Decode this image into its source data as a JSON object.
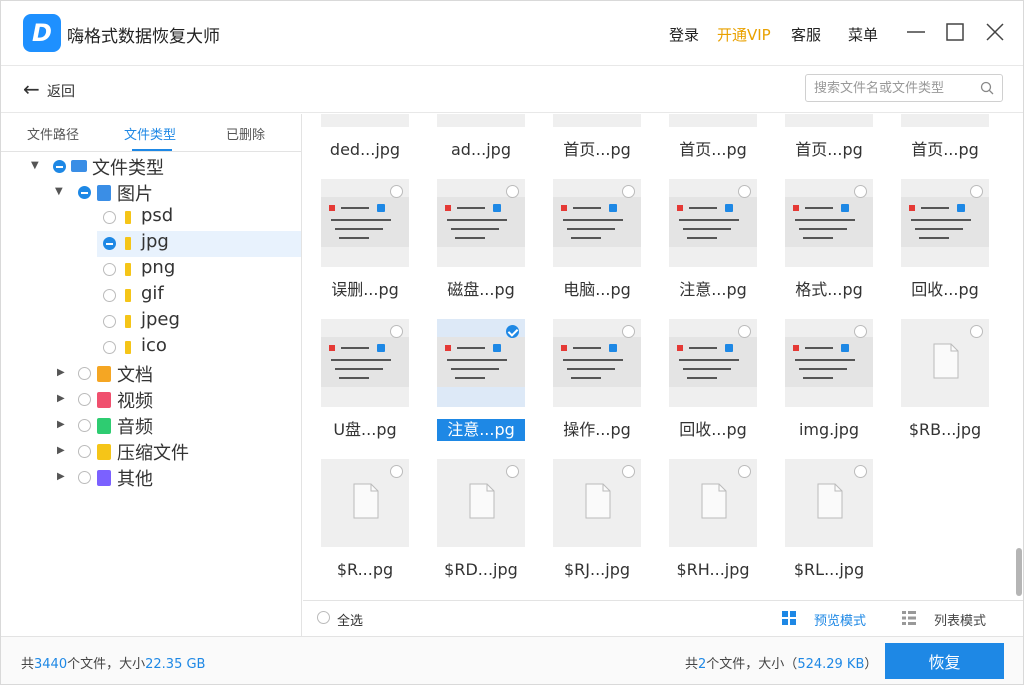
{
  "app": {
    "title": "嗨格式数据恢复大师",
    "logo_letter": "D"
  },
  "titlebar": {
    "login": "登录",
    "vip": "开通VIP",
    "service": "客服",
    "menu": "菜单"
  },
  "nav": {
    "back_label": "返回",
    "search_placeholder": "搜索文件名或文件类型"
  },
  "tabs": [
    "文件路径",
    "文件类型",
    "已删除"
  ],
  "tree": {
    "root": "文件类型",
    "images": "图片",
    "image_types": [
      "psd",
      "jpg",
      "png",
      "gif",
      "jpeg",
      "ico"
    ],
    "categories": [
      {
        "label": "文档",
        "color": "#f5a623"
      },
      {
        "label": "视频",
        "color": "#f0506e"
      },
      {
        "label": "音频",
        "color": "#2ecc71"
      },
      {
        "label": "压缩文件",
        "color": "#f5c518"
      },
      {
        "label": "其他",
        "color": "#7b61ff"
      }
    ]
  },
  "grid": {
    "rows": [
      [
        "ded...jpg",
        "ad...jpg",
        "首页...pg",
        "首页...pg",
        "首页...pg",
        "首页...pg"
      ],
      [
        "误删...pg",
        "磁盘...pg",
        "电脑...pg",
        "注意...pg",
        "格式...pg",
        "回收...pg"
      ],
      [
        "U盘...pg",
        "注意...pg",
        "操作...pg",
        "回收...pg",
        "img.jpg",
        "$RB...jpg"
      ],
      [
        "$R...pg",
        "$RD...jpg",
        "$RJ...jpg",
        "$RH...jpg",
        "$RL...jpg"
      ]
    ],
    "selected": "注意...pg"
  },
  "footer": {
    "select_all": "全选",
    "preview_mode": "预览模式",
    "list_mode": "列表模式"
  },
  "status": {
    "total_prefix": "共",
    "total_count": "3440",
    "total_mid": "个文件，大小",
    "total_size": "22.35 GB",
    "sel_prefix": "共",
    "sel_count": "2",
    "sel_mid": "个文件，大小（",
    "sel_size": "524.29 KB",
    "sel_suffix": "）",
    "recover_button": "恢复"
  }
}
